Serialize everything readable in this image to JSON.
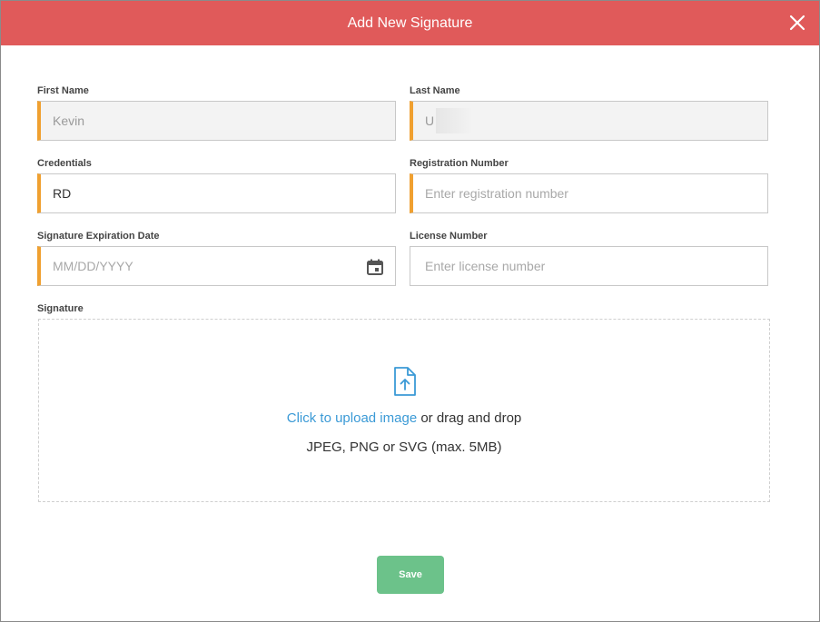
{
  "modal": {
    "title": "Add New Signature",
    "close_icon": "close-icon"
  },
  "form": {
    "first_name": {
      "label": "First Name",
      "value": "Kevin",
      "disabled": true,
      "required": true
    },
    "last_name": {
      "label": "Last Name",
      "value": "U",
      "disabled": true,
      "required": true,
      "partially_redacted": true
    },
    "credentials": {
      "label": "Credentials",
      "value": "RD",
      "required": true
    },
    "registration_number": {
      "label": "Registration Number",
      "value": "",
      "placeholder": "Enter registration number",
      "required": true
    },
    "signature_expiration_date": {
      "label": "Signature Expiration Date",
      "value": "",
      "placeholder": "MM/DD/YYYY",
      "required": true,
      "icon": "calendar-icon"
    },
    "license_number": {
      "label": "License Number",
      "value": "",
      "placeholder": "Enter license number",
      "required": false
    }
  },
  "signature": {
    "label": "Signature",
    "upload_icon": "file-upload-icon",
    "upload_link": "Click to upload image",
    "upload_suffix": " or drag and drop",
    "formats": "JPEG, PNG or SVG (max. 5MB)"
  },
  "actions": {
    "save_label": "Save"
  },
  "colors": {
    "header": "#e05a5a",
    "required_accent": "#f0a030",
    "link": "#3b9ad6",
    "save_button": "#6cc28a"
  }
}
